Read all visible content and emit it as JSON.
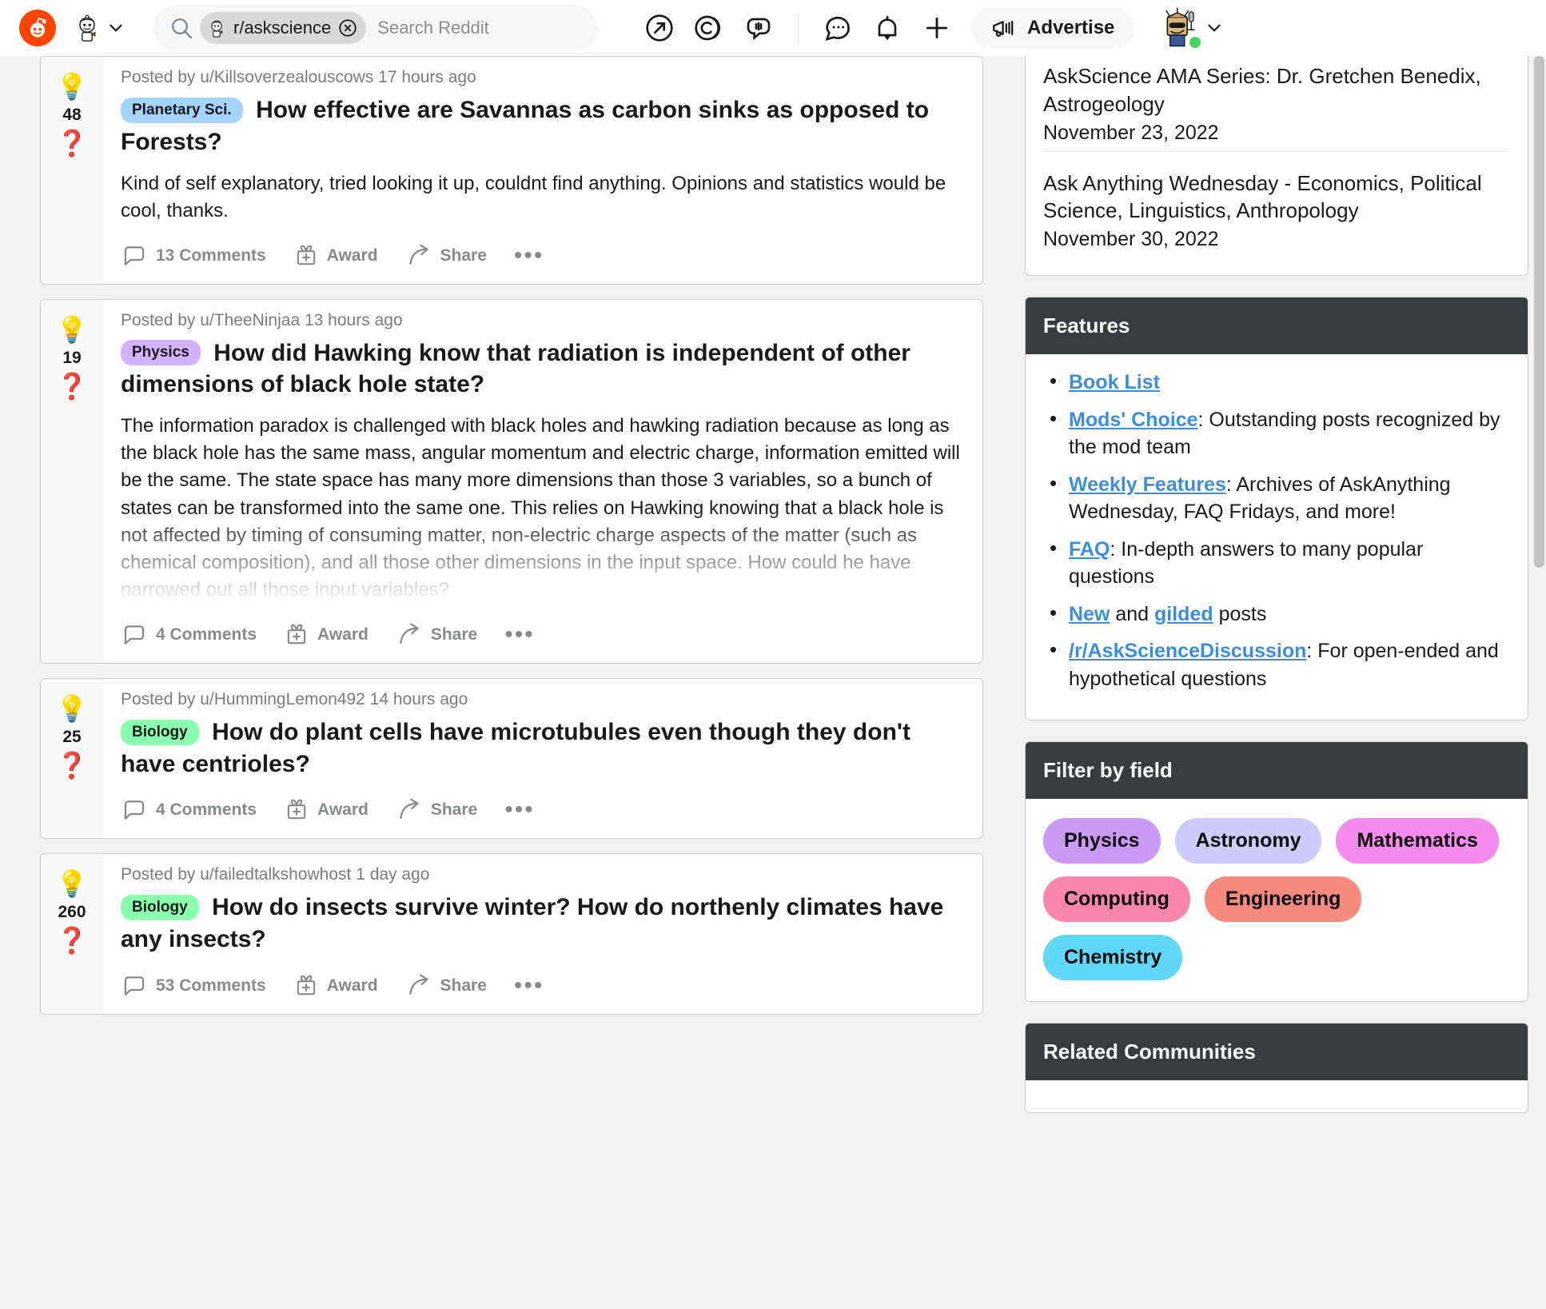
{
  "header": {
    "logo_icon": "reddit-logo-icon",
    "snoo_icon": "snoo-avatar-icon",
    "chevron_icon": "chevron-down-icon",
    "search": {
      "icon": "search-icon",
      "chip_label": "r/askscience",
      "chip_clear_icon": "clear-x-icon",
      "placeholder": "Search Reddit"
    },
    "icons": [
      {
        "name": "popular-arrow-icon",
        "label": "Popular"
      },
      {
        "name": "coins-icon",
        "label": "Reddit Coins"
      },
      {
        "name": "chat-bubble-icon",
        "label": "Chat"
      }
    ],
    "icons_right": [
      {
        "name": "messages-icon",
        "label": "Messages"
      },
      {
        "name": "notifications-bell-icon",
        "label": "Notifications"
      },
      {
        "name": "create-plus-icon",
        "label": "Create Post"
      }
    ],
    "advertise": {
      "label": "Advertise",
      "icon": "megaphone-icon"
    },
    "user": {
      "avatar_icon": "user-avatar-icon",
      "online": true,
      "chevron_icon": "chevron-down-icon"
    }
  },
  "feed": {
    "posts": [
      {
        "upvote_icon": "lightbulb-upvote-icon",
        "downvote_icon": "question-mark-downvote-icon",
        "score": "48",
        "meta": "Posted by u/Killsoverzealouscows 17 hours ago",
        "flair": {
          "label": "Planetary Sci.",
          "bg": "#a5d3ff",
          "color": "#1a1a1b"
        },
        "title": "How effective are Savannas as carbon sinks as opposed to Forests?",
        "body": "Kind of self explanatory, tried looking it up, couldnt find anything. Opinions and statistics would be cool, thanks.",
        "faded": false,
        "comments": "13 Comments",
        "award": "Award",
        "share": "Share",
        "more": "•••"
      },
      {
        "upvote_icon": "lightbulb-upvote-icon",
        "downvote_icon": "question-mark-downvote-icon",
        "score": "19",
        "meta": "Posted by u/TheeNinjaa 13 hours ago",
        "flair": {
          "label": "Physics",
          "bg": "#d3b3ff",
          "color": "#1a1a1b"
        },
        "title": "How did Hawking know that radiation is independent of other dimensions of black hole state?",
        "body": "The information paradox is challenged with black holes and hawking radiation because as long as the black hole has the same mass, angular momentum and electric charge, information emitted will be the same. The state space has many more dimensions than those 3 variables, so a bunch of states can be transformed into the same one. This relies on Hawking knowing that a black hole is not affected by timing of consuming matter, non-electric charge aspects of the matter (such as chemical composition), and all those other dimensions in the input space. How could he have narrowed out all those input variables?",
        "faded": true,
        "comments": "4 Comments",
        "award": "Award",
        "share": "Share",
        "more": "•••"
      },
      {
        "upvote_icon": "lightbulb-upvote-icon",
        "downvote_icon": "question-mark-downvote-icon",
        "score": "25",
        "meta": "Posted by u/HummingLemon492 14 hours ago",
        "flair": {
          "label": "Biology",
          "bg": "#8affb0",
          "color": "#1a1a1b"
        },
        "title": "How do plant cells have microtubules even though they don't have centrioles?",
        "body": "",
        "faded": false,
        "comments": "4 Comments",
        "award": "Award",
        "share": "Share",
        "more": "•••"
      },
      {
        "upvote_icon": "lightbulb-upvote-icon",
        "downvote_icon": "question-mark-downvote-icon",
        "score": "260",
        "meta": "Posted by u/failedtalkshowhost 1 day ago",
        "flair": {
          "label": "Biology",
          "bg": "#8affb0",
          "color": "#1a1a1b"
        },
        "title": "How do insects survive winter? How do northenly climates have any insects?",
        "body": "",
        "faded": false,
        "comments": "53 Comments",
        "award": "Award",
        "share": "Share",
        "more": "•••"
      }
    ]
  },
  "sidebar": {
    "ama": {
      "items": [
        {
          "title": "AskScience AMA Series: Dr. Gretchen Benedix, Astrogeology",
          "date": "November 23, 2022"
        },
        {
          "title": "Ask Anything Wednesday - Economics, Political Science, Linguistics, Anthropology",
          "date": "November 30, 2022"
        }
      ]
    },
    "features": {
      "title": "Features",
      "items": [
        {
          "link": "Book List",
          "rest": ""
        },
        {
          "link": "Mods' Choice",
          "rest": ": Outstanding posts recognized by the mod team"
        },
        {
          "link": "Weekly Features",
          "rest": ": Archives of AskAnything Wednesday, FAQ Fridays, and more!"
        },
        {
          "link": "FAQ",
          "rest": ": In-depth answers to many popular questions"
        },
        {
          "link": "New",
          "rest": " and ",
          "link2": "gilded",
          "rest2": " posts"
        },
        {
          "link": "/r/AskScienceDiscussion",
          "rest": ": For open-ended and hypothetical questions"
        }
      ]
    },
    "filter": {
      "title": "Filter by field",
      "pills": [
        {
          "label": "Physics",
          "bg": "#cb9af5"
        },
        {
          "label": "Astronomy",
          "bg": "#cdcbf7"
        },
        {
          "label": "Mathematics",
          "bg": "#f58ced"
        },
        {
          "label": "Computing",
          "bg": "#f986ac"
        },
        {
          "label": "Engineering",
          "bg": "#f58b7e"
        },
        {
          "label": "Chemistry",
          "bg": "#61d6f5"
        }
      ]
    },
    "related": {
      "title": "Related Communities"
    }
  }
}
